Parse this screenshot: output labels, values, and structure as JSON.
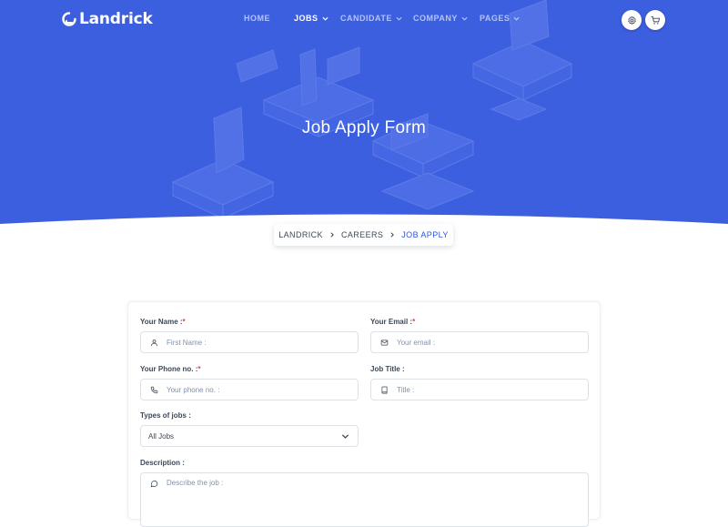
{
  "brand": {
    "name": "Landrick"
  },
  "nav": {
    "items": [
      {
        "label": "HOME",
        "active": false,
        "has_dropdown": false
      },
      {
        "label": "JOBS",
        "active": true,
        "has_dropdown": true
      },
      {
        "label": "CANDIDATE",
        "active": false,
        "has_dropdown": true
      },
      {
        "label": "COMPANY",
        "active": false,
        "has_dropdown": true
      },
      {
        "label": "PAGES",
        "active": false,
        "has_dropdown": true
      }
    ],
    "icons": [
      "settings-icon",
      "cart-icon"
    ]
  },
  "hero": {
    "title": "Job Apply Form"
  },
  "breadcrumb": {
    "items": [
      {
        "label": "LANDRICK",
        "active": false
      },
      {
        "label": "CAREERS",
        "active": false
      },
      {
        "label": "JOB APPLY",
        "active": true
      }
    ]
  },
  "form": {
    "name": {
      "label": "Your Name :",
      "required": "*",
      "placeholder": "First Name :",
      "icon": "user-icon"
    },
    "email": {
      "label": "Your Email :",
      "required": "*",
      "placeholder": "Your email :",
      "icon": "mail-icon"
    },
    "phone": {
      "label": "Your Phone no. :",
      "required": "*",
      "placeholder": "Your phone no. :",
      "icon": "phone-icon"
    },
    "job_title": {
      "label": "Job Title :",
      "placeholder": "Title :",
      "icon": "book-icon"
    },
    "job_types": {
      "label": "Types of jobs :",
      "selected": "All Jobs"
    },
    "description": {
      "label": "Description :",
      "placeholder": "Describe the job :",
      "icon": "message-circle-icon"
    }
  },
  "colors": {
    "primary": "#2f55d4",
    "hero_bg": "#3c5fe0",
    "required": "#e43f52",
    "text_dark": "#3c4858",
    "placeholder": "#8492a6",
    "border": "#dee2e6"
  }
}
